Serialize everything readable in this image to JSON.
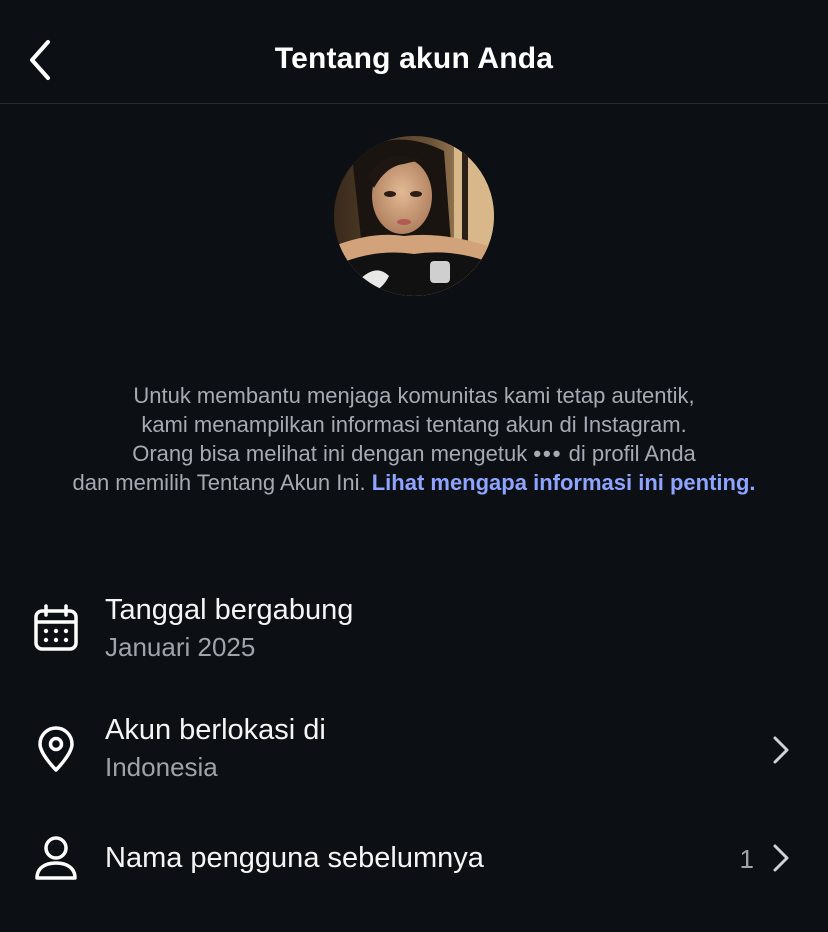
{
  "header": {
    "title": "Tentang akun Anda",
    "back_icon": "chevron-left-icon"
  },
  "description": {
    "text_line_1": "Untuk membantu menjaga komunitas kami tetap autentik,",
    "text_line_2": "kami menampilkan informasi tentang akun di Instagram.",
    "text_line_3a": "Orang bisa melihat ini dengan mengetuk",
    "dots": "•••",
    "text_line_3b": "di profil Anda",
    "text_line_4": "dan memilih Tentang Akun Ini.",
    "link_text": "Lihat mengapa informasi ini penting."
  },
  "rows": [
    {
      "icon": "calendar-icon",
      "title": "Tanggal bergabung",
      "subtitle": "Januari 2025"
    },
    {
      "icon": "location-pin-icon",
      "title": "Akun berlokasi di",
      "subtitle": "Indonesia",
      "chevron": "chevron-right-icon"
    },
    {
      "icon": "user-icon",
      "title": "Nama pengguna sebelumnya",
      "count": "1",
      "chevron": "chevron-right-icon"
    }
  ],
  "colors": {
    "background": "#0c0f14",
    "link": "#8ea4ff",
    "secondary_text": "#a6abb3"
  }
}
